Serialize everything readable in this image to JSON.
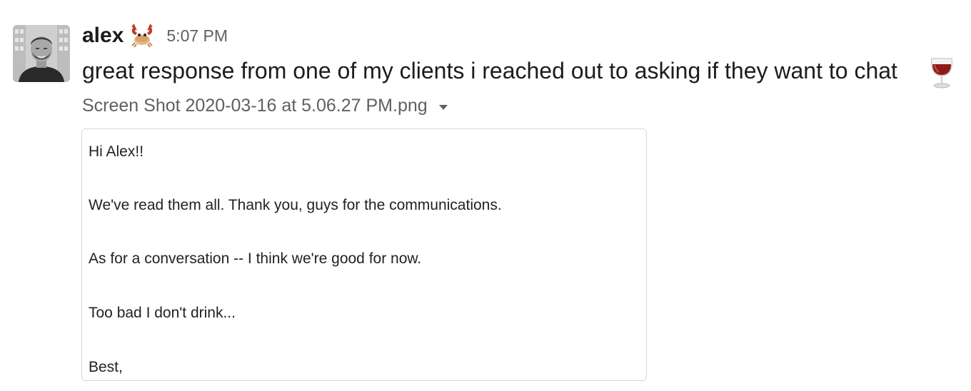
{
  "message": {
    "author": "alex",
    "status_emoji": "crab-emoji",
    "timestamp": "5:07 PM",
    "text": "great response from one of my clients i reached out to asking if they want to chat",
    "trailing_emoji": "wine-glass-emoji",
    "attachment": {
      "file_name": "Screen Shot 2020-03-16 at 5.06.27 PM.png",
      "menu_icon": "caret-down-icon",
      "email_lines": [
        "Hi Alex!!",
        "We've read them all. Thank you, guys for the communications.",
        "As for a conversation -- I think we're good for now.",
        "Too bad I don't drink...",
        "Best,"
      ]
    }
  },
  "colors": {
    "text_primary": "#1d1c1d",
    "text_secondary": "#616061",
    "attachment_border": "#d8d8d8"
  }
}
